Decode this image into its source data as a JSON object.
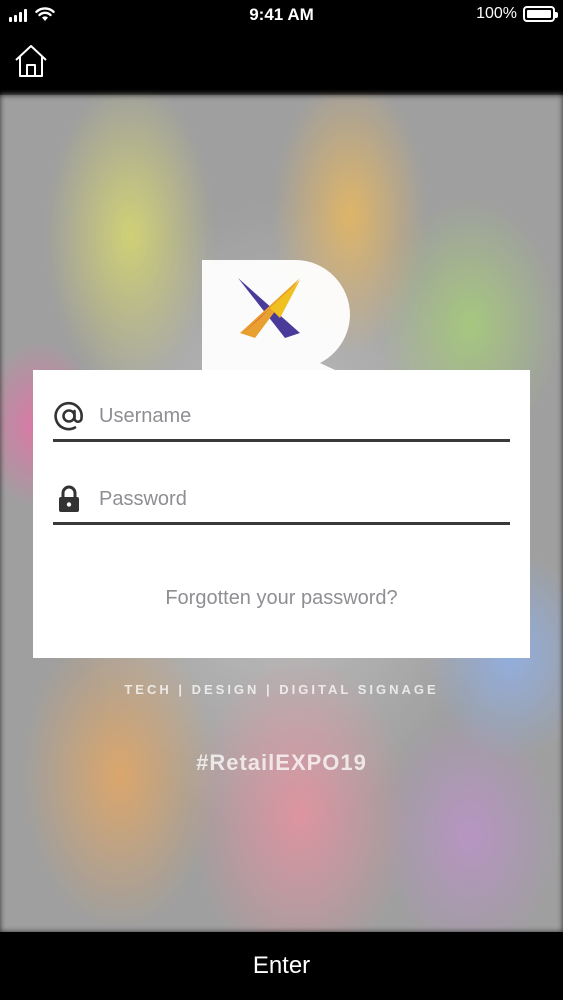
{
  "status_bar": {
    "time": "9:41 AM",
    "battery_percent": "100%",
    "battery_level": 1.0,
    "icons": [
      "cellular-signal-icon",
      "wifi-icon",
      "battery-icon"
    ]
  },
  "nav": {
    "home_icon": "home-icon"
  },
  "background": {
    "tagline": "TECH | DESIGN | DIGITAL SIGNAGE",
    "hashtag": "#RetailEXPO19"
  },
  "login": {
    "username": {
      "icon": "at-sign-icon",
      "placeholder": "Username",
      "value": ""
    },
    "password": {
      "icon": "lock-icon",
      "placeholder": "Password",
      "value": ""
    },
    "forgot_password_label": "Forgotten your password?"
  },
  "footer": {
    "enter_label": "Enter"
  },
  "colors": {
    "bar_background": "#000000",
    "card_background": "#ffffff",
    "placeholder": "#8e8e93",
    "underline": "#3a3a3a"
  }
}
